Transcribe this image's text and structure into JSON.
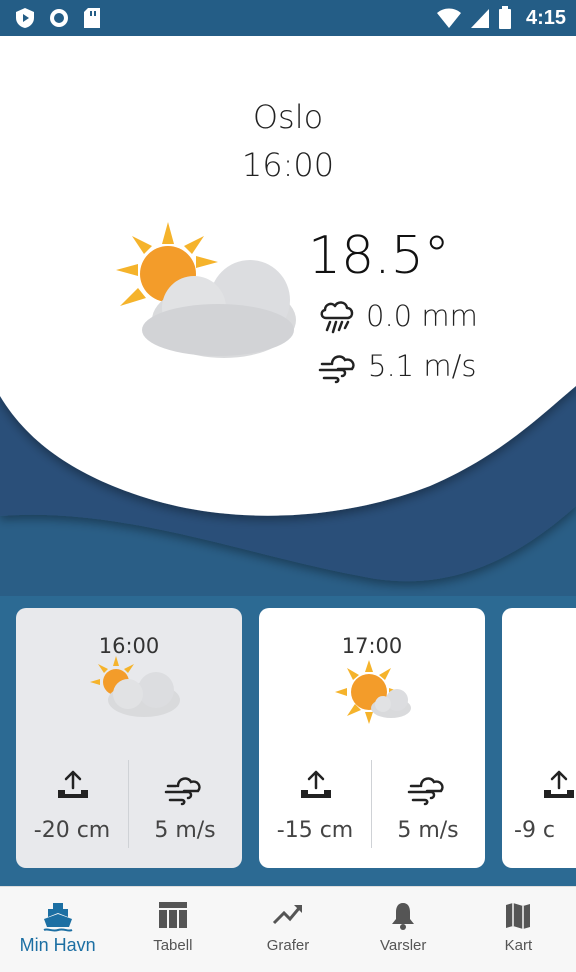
{
  "status_bar": {
    "time": "4:15"
  },
  "header": {
    "city": "Oslo",
    "time": "16:00"
  },
  "current": {
    "temperature": "18.5°",
    "precipitation": "0.0 mm",
    "wind": "5.1 m/s",
    "icon": "partly-cloudy-icon"
  },
  "cards": [
    {
      "time": "16:00",
      "tide": "-20 cm",
      "wind": "5 m/s",
      "selected": true
    },
    {
      "time": "17:00",
      "tide": "-15 cm",
      "wind": "5 m/s",
      "selected": false
    },
    {
      "time": "",
      "tide": "-9 c",
      "wind": "",
      "selected": false
    }
  ],
  "nav": [
    {
      "label": "Min Havn",
      "icon": "boat-icon",
      "active": true
    },
    {
      "label": "Tabell",
      "icon": "table-icon",
      "active": false
    },
    {
      "label": "Grafer",
      "icon": "trending-up-icon",
      "active": false
    },
    {
      "label": "Varsler",
      "icon": "bell-icon",
      "active": false
    },
    {
      "label": "Kart",
      "icon": "map-icon",
      "active": false
    }
  ],
  "colors": {
    "accent": "#1c6fa3",
    "wave_light": "#2f7fae",
    "wave_dark": "#2b5278",
    "status_bar": "#245d86"
  }
}
